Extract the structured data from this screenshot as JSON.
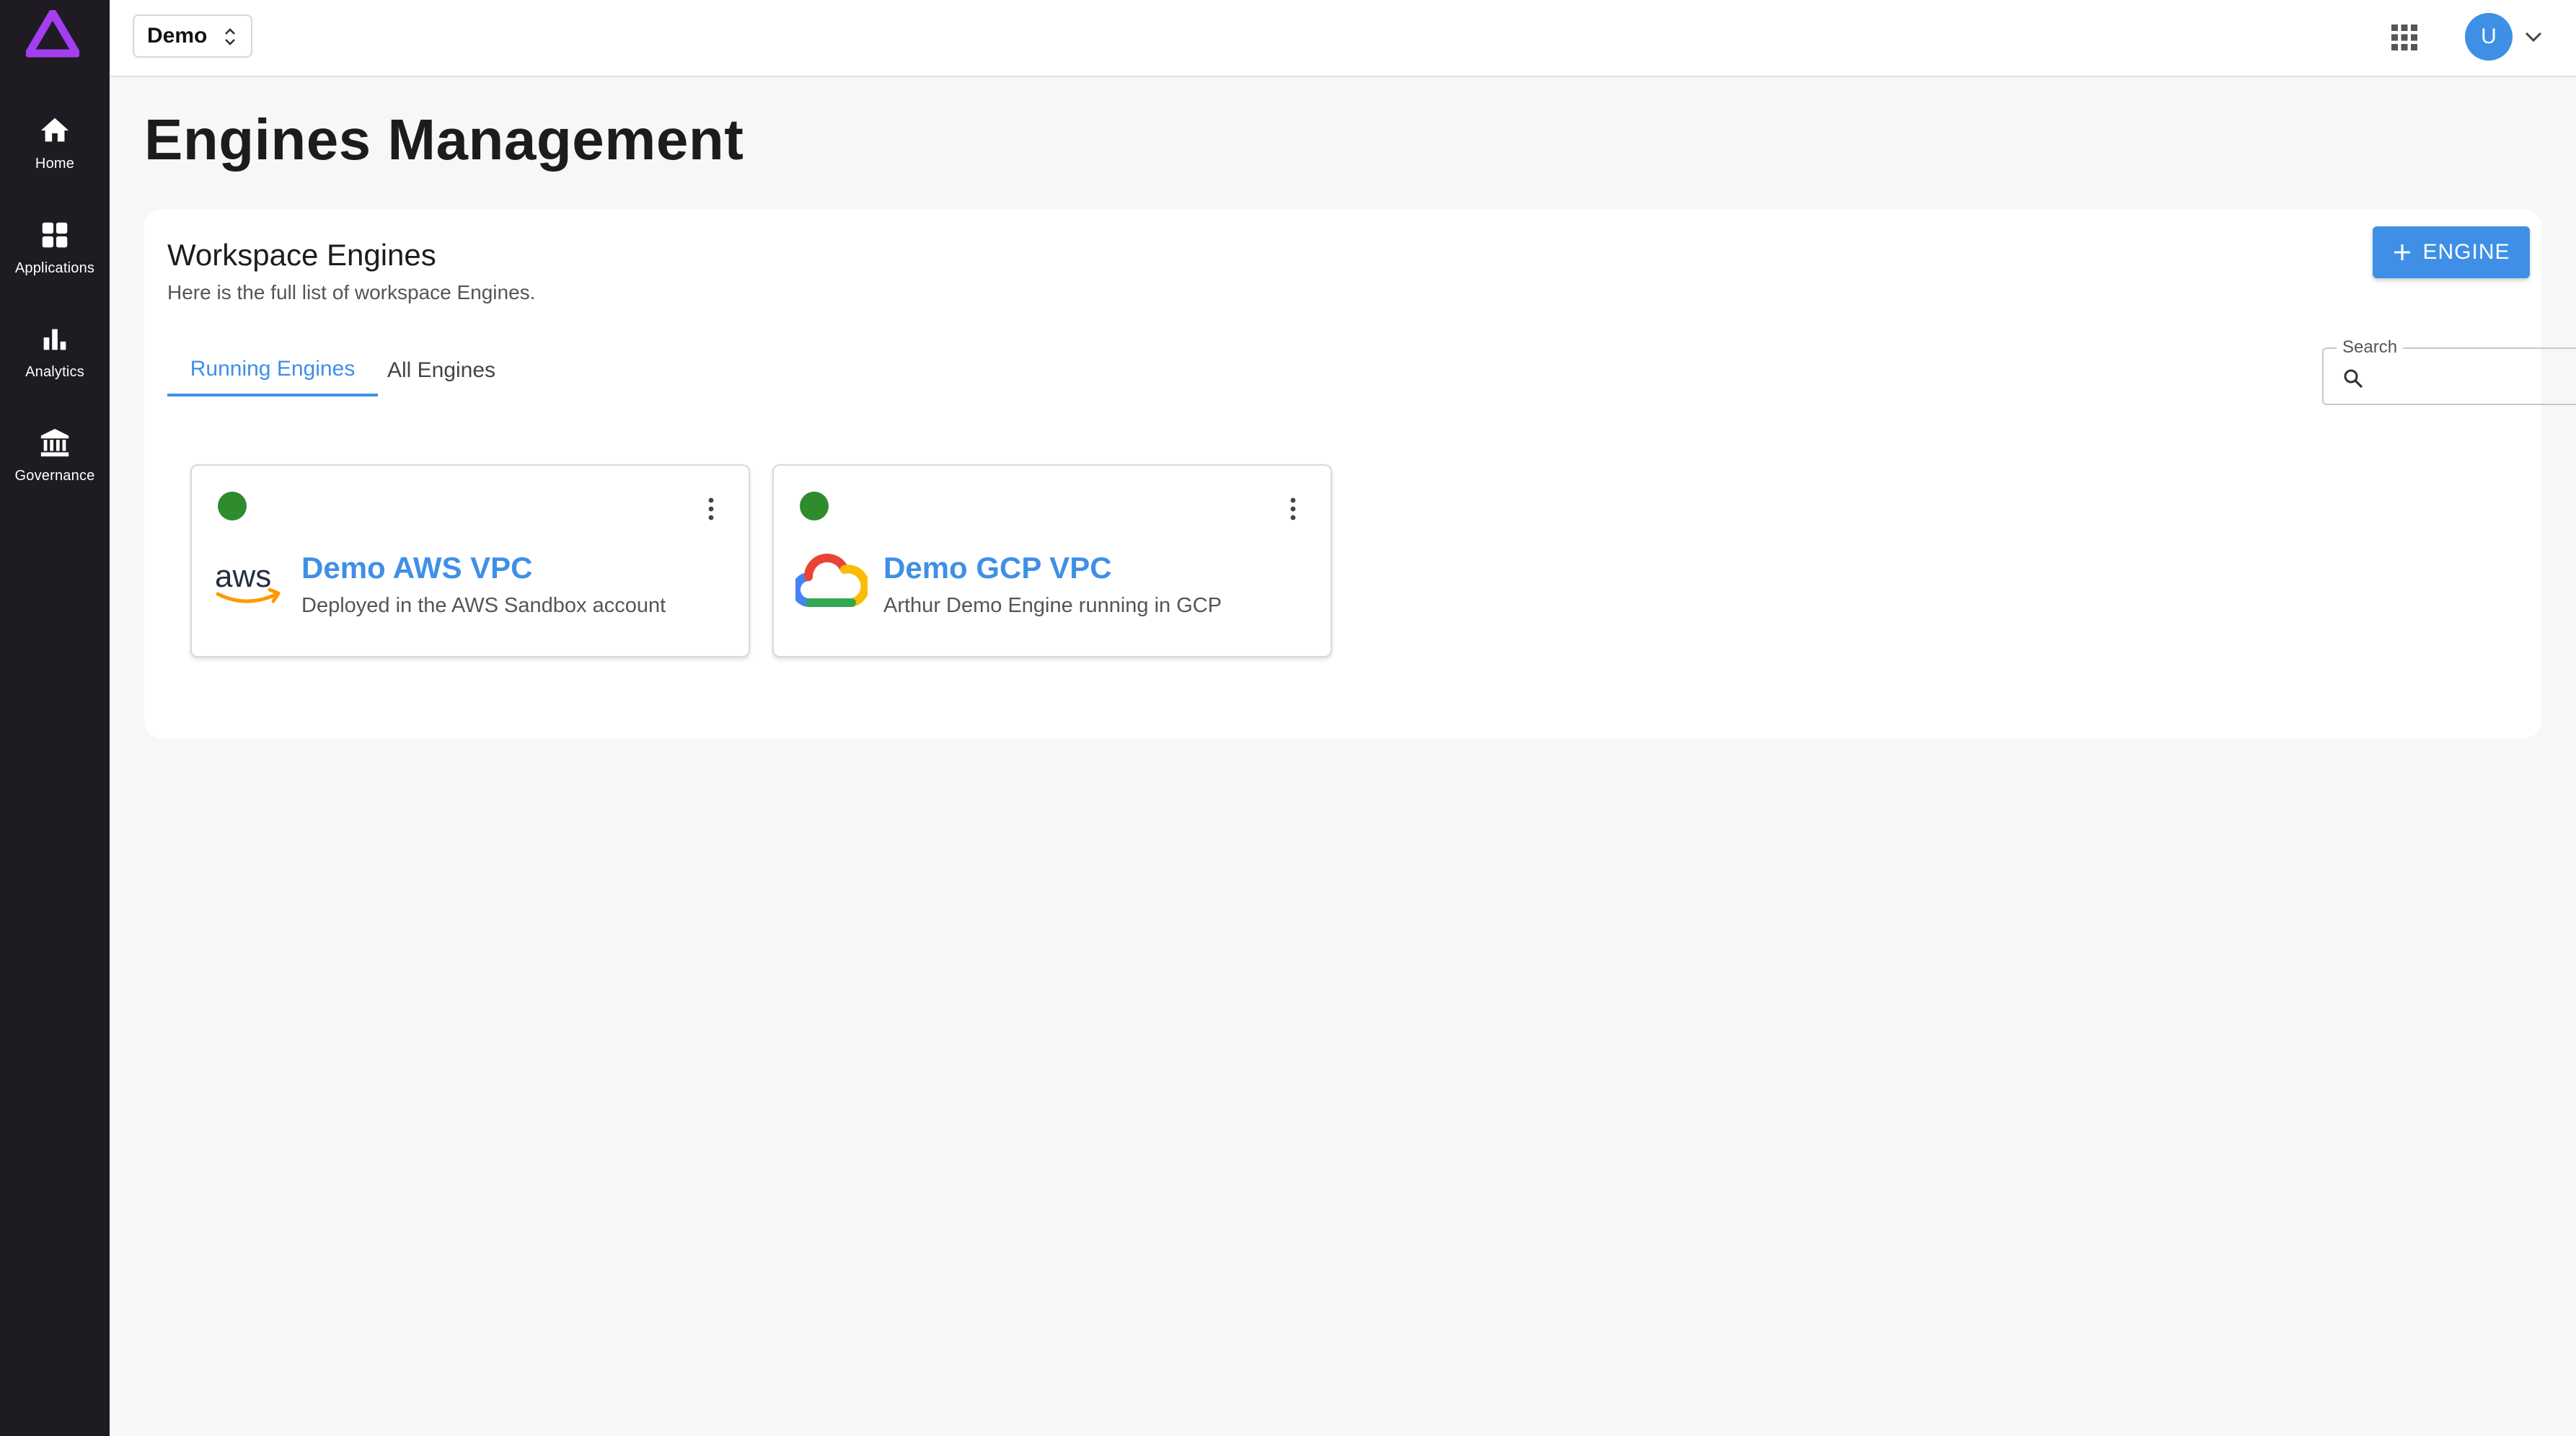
{
  "nav": {
    "items": [
      {
        "label": "Home",
        "icon": "home-icon"
      },
      {
        "label": "Applications",
        "icon": "grid-icon"
      },
      {
        "label": "Analytics",
        "icon": "bar-chart-icon"
      },
      {
        "label": "Governance",
        "icon": "bank-icon"
      }
    ]
  },
  "topbar": {
    "workspace": "Demo",
    "avatar_initial": "U"
  },
  "page": {
    "title": "Engines Management"
  },
  "section": {
    "title": "Workspace Engines",
    "subtitle": "Here is the full list of workspace Engines.",
    "add_button_label": "ENGINE"
  },
  "tabs": [
    {
      "label": "Running Engines",
      "active": true
    },
    {
      "label": "All Engines",
      "active": false
    }
  ],
  "search": {
    "label": "Search",
    "value": ""
  },
  "engines": [
    {
      "name": "Demo AWS VPC",
      "description": "Deployed in the AWS Sandbox account",
      "provider": "aws",
      "status": "running"
    },
    {
      "name": "Demo GCP VPC",
      "description": "Arthur Demo Engine running in GCP",
      "provider": "gcp",
      "status": "running"
    }
  ],
  "colors": {
    "accent": "#3f8fe6",
    "sidebar": "#1e1c22",
    "status_running": "#2e8b2e",
    "logo": "#a43ef0"
  }
}
